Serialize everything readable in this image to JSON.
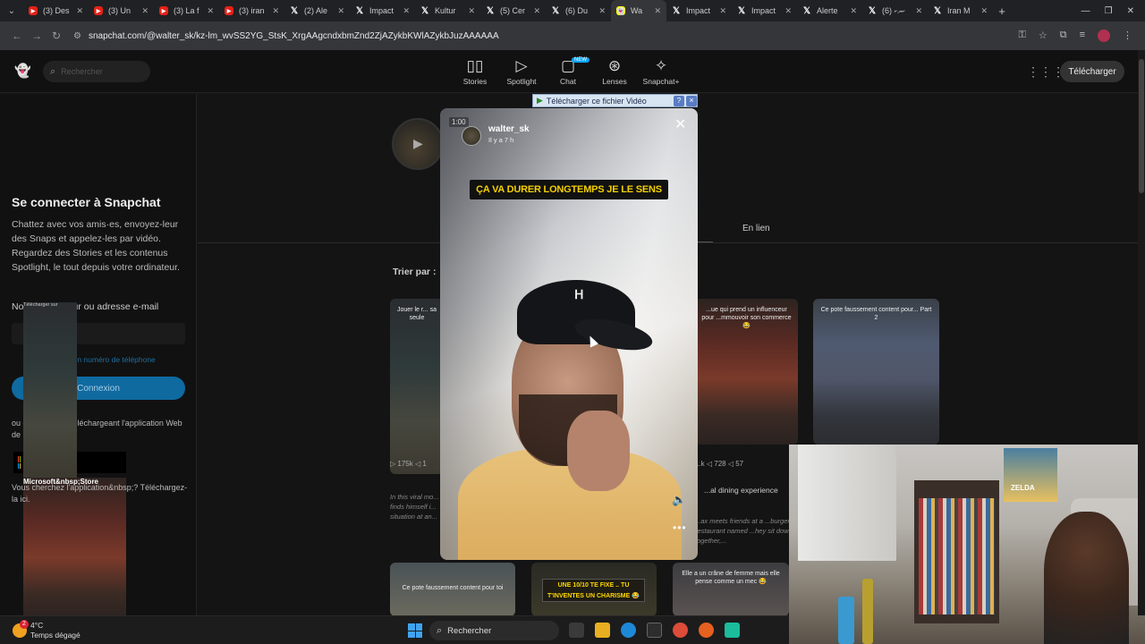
{
  "browser": {
    "tabs": [
      {
        "icon": "yt",
        "label": "(3) Des"
      },
      {
        "icon": "yt",
        "label": "(3) Un"
      },
      {
        "icon": "yt",
        "label": "(3) La f"
      },
      {
        "icon": "yt",
        "label": "(3) iran"
      },
      {
        "icon": "x",
        "label": "(2) Ale"
      },
      {
        "icon": "x",
        "label": "Impact"
      },
      {
        "icon": "x",
        "label": "Kultur"
      },
      {
        "icon": "x",
        "label": "(5) Cer"
      },
      {
        "icon": "x",
        "label": "(6) Du"
      },
      {
        "icon": "sc",
        "label": "Wa",
        "active": true
      },
      {
        "icon": "x",
        "label": "Impact"
      },
      {
        "icon": "x",
        "label": "Impact"
      },
      {
        "icon": "x",
        "label": "Alerte"
      },
      {
        "icon": "x",
        "label": "ކޔކ (6)"
      },
      {
        "icon": "x",
        "label": "Iran M"
      }
    ],
    "url": "snapchat.com/@walter_sk/kz-lm_wvSS2YG_StsK_XrgAAgcndxbmZnd2ZjAZykbKWlAZykbJuzAAAAAA"
  },
  "header": {
    "search_placeholder": "Rechercher",
    "nav": [
      {
        "label": "Stories",
        "icon": "stories-icon"
      },
      {
        "label": "Spotlight",
        "icon": "play-icon"
      },
      {
        "label": "Chat",
        "icon": "chat-icon",
        "badge": "NEW"
      },
      {
        "label": "Lenses",
        "icon": "lenses-icon"
      },
      {
        "label": "Snapchat+",
        "icon": "ghost-plus-icon"
      }
    ],
    "download_label": "Télécharger"
  },
  "sidebar": {
    "title": "Se connecter à Snapchat",
    "description": "Chattez avec vos amis·es, envoyez-leur des Snaps et appelez-les par vidéo. Regardez des Stories et les contenus Spotlight, le tout depuis votre ordinateur.",
    "username_label": "Nom d'utilisateur ou adresse e-mail",
    "phone_link": "Utiliser mon numéro de téléphone",
    "login_label": "Connexion",
    "continue_text": "ou continuez en téléchargeant l'application Web de Snapchat",
    "ms_store_small": "Télécharger sur",
    "ms_store_big": "Microsoft&nbsp;Store",
    "app_question": "Vous cherchez l'application&nbsp;? Téléchargez-la ici."
  },
  "main": {
    "tab_link": "En lien",
    "sort_label": "Trier par :",
    "thumbs": [
      {
        "caption": "Jouer le r... sa seule"
      },
      {
        "caption": "...ue qui prend un influenceur pour ...mmouvoir son commerce 😂"
      },
      {
        "caption": "Ce pote faussement content pour... Part 2"
      }
    ],
    "stats_left": "▷ 175k  ◁ 1",
    "stats_right": "...k  ◁ 728  ◁ 57",
    "desc_left": "In this viral mo... finds himself i... situation at an...",
    "title_right": "...al dining experience",
    "desc_right": "...ax meets friends at a ...burger restaurant named ...hey sit down together,...",
    "bottom_caption1": "Ce pote faussement content pour toi",
    "bottom_caption2": "UNE 10/10 TE FIXE .. TU T'INVENTES UN CHARISME 😂",
    "bottom_caption3": "Elle a un crâne de femme mais elle pense comme un mec 😂"
  },
  "story": {
    "timer": "1:00",
    "username": "walter_sk",
    "time_ago": "Il y a 7 h",
    "caption": "ÇA VA DURER LONGTEMPS JE LE SENS"
  },
  "download_bar": {
    "label": "Télécharger ce fichier Vidéo",
    "help": "?",
    "close": "×"
  },
  "taskbar": {
    "temp": "4°C",
    "weather": "Temps dégagé",
    "notif": "2",
    "search": "Rechercher"
  }
}
